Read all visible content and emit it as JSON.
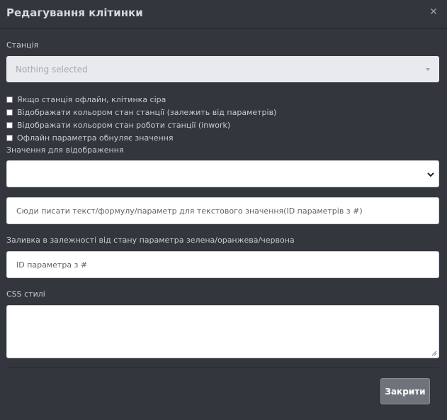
{
  "modal": {
    "title": "Редагування клітинки",
    "close_icon": "close-icon"
  },
  "station": {
    "label": "Станція",
    "placeholder": "Nothing selected"
  },
  "options": [
    {
      "label": "Якщо станція офлайн, клітинка сіра",
      "checked": false
    },
    {
      "label": "Відображати кольором стан станції (залежить від параметрів)",
      "checked": false
    },
    {
      "label": "Відображати кольором стан роботи станції (inwork)",
      "checked": false
    },
    {
      "label": "Офлайн параметра обнуляє значення",
      "checked": false
    }
  ],
  "display_value": {
    "label": "Значення для відображення",
    "value": ""
  },
  "text_formula": {
    "placeholder": "Сюди писати текст/формулу/параметр для текстового значення(ID параметрів з #)"
  },
  "fill": {
    "label": "Заливка в залежності від стану параметра зелена/оранжева/червона",
    "placeholder": "ID параметра з #"
  },
  "css": {
    "label": "CSS стилі",
    "value": ""
  },
  "footer": {
    "close_label": "Закрити"
  }
}
